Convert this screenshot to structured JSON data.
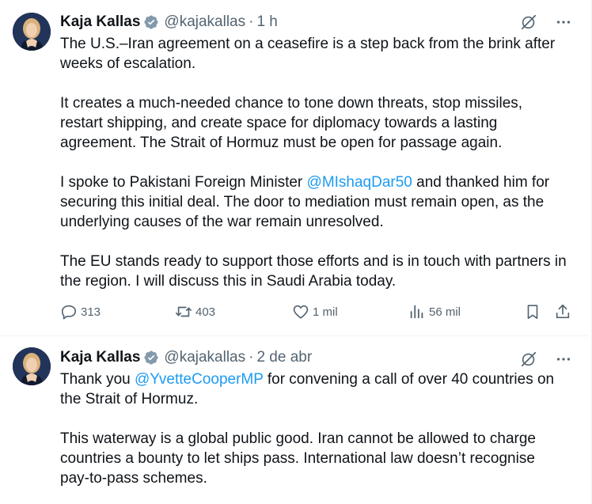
{
  "tweets": [
    {
      "author": {
        "name": "Kaja Kallas",
        "handle": "@kajakallas",
        "separator": "·",
        "time": "1 h"
      },
      "body": {
        "p1": "The U.S.–Iran agreement on a ceasefire is a step back from the brink after weeks of escalation.",
        "p2": "It creates a much-needed chance to tone down threats, stop missiles, restart shipping, and create space for diplomacy towards a lasting agreement. The Strait of Hormuz must be open for passage again.",
        "p3_before": "I spoke to Pakistani Foreign Minister ",
        "p3_mention": "@MIshaqDar50",
        "p3_after": " and thanked him for securing this initial deal. The door to mediation must remain open, as the underlying causes of the war remain unresolved.",
        "p4": "The EU stands ready to support those efforts and is in touch with partners in the region. I will discuss this in Saudi Arabia today."
      },
      "metrics": {
        "replies": "313",
        "reposts": "403",
        "likes": "1 mil",
        "views": "56 mil"
      }
    },
    {
      "author": {
        "name": "Kaja Kallas",
        "handle": "@kajakallas",
        "separator": "·",
        "time": "2 de abr"
      },
      "body": {
        "p1_before": "Thank you ",
        "p1_mention": "@YvetteCooperMP",
        "p1_after": " for convening a call of over 40 countries on the Strait of Hormuz.",
        "p2": "This waterway is a global public good. Iran cannot be allowed to charge countries a bounty to let ships pass. International law doesn’t recognise pay-to-pass schemes."
      }
    }
  ],
  "colors": {
    "text": "#0f1419",
    "secondary": "#536471",
    "link": "#1d9bf0",
    "verified": "#829aab",
    "divider": "#eff3f4"
  },
  "icons": {
    "verified": "verified-badge-icon",
    "grok": "grok-icon",
    "more": "more-icon",
    "reply": "reply-icon",
    "repost": "repost-icon",
    "like": "heart-icon",
    "views": "views-icon",
    "bookmark": "bookmark-icon",
    "share": "share-icon"
  }
}
